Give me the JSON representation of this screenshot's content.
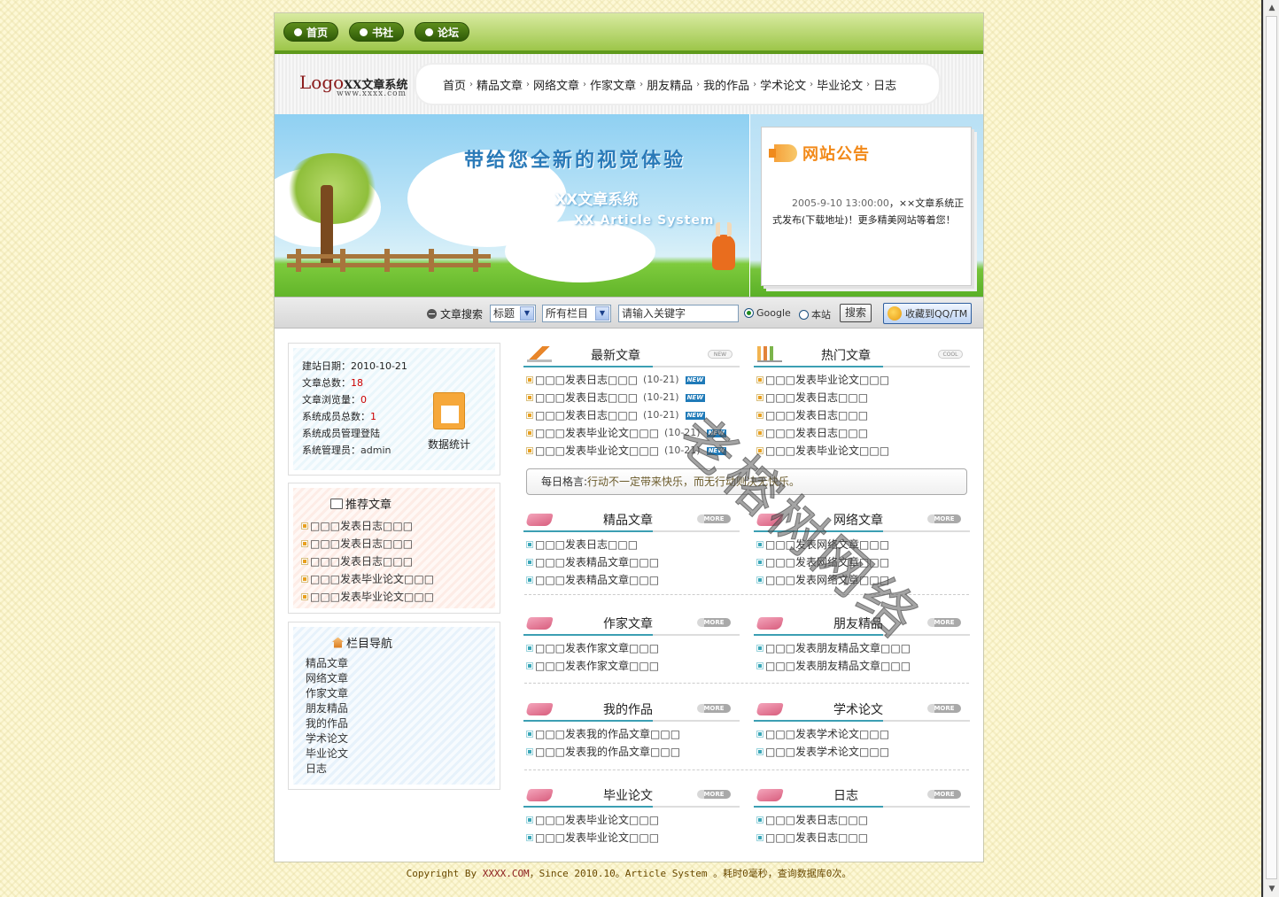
{
  "topnav": [
    "首页",
    "书社",
    "论坛"
  ],
  "logo": {
    "logo": "Logo",
    "name": "XX文章系统",
    "url": "www.xxxx.com"
  },
  "menu": [
    "首页",
    "精品文章",
    "网络文章",
    "作家文章",
    "朋友精品",
    "我的作品",
    "学术论文",
    "毕业论文",
    "日志"
  ],
  "menu_sep": "›",
  "banner": {
    "slogan": "带给您全新的视觉体验",
    "sys_cn": "XX文章系统",
    "sys_en": "XX Article System"
  },
  "notice": {
    "title": "网站公告",
    "date": "2005-9-10 13:00:00",
    "text": "，××文章系统正式发布(下载地址)！更多精美网站等着您！"
  },
  "search": {
    "label": "文章搜索",
    "field": "标题",
    "column": "所有栏目",
    "keyword": "请输入关键字",
    "opt_google": "Google",
    "opt_site": "本站",
    "button": "搜索",
    "fav": "收藏到QQ/TM"
  },
  "stats": {
    "rows": [
      {
        "label": "建站日期：",
        "value": "2010-10-21"
      },
      {
        "label": "文章总数：",
        "value": "18"
      },
      {
        "label": "文章浏览量：",
        "value": "0"
      },
      {
        "label": "系统成员总数：",
        "value": "1"
      },
      {
        "label": "系统成员管理登陆",
        "value": ""
      },
      {
        "label": "系统管理员：",
        "value": "admin"
      }
    ],
    "icon_label": "数据统计"
  },
  "recommend": {
    "title": "推荐文章",
    "items": [
      "□□□发表日志□□□",
      "□□□发表日志□□□",
      "□□□发表日志□□□",
      "□□□发表毕业论文□□□",
      "□□□发表毕业论文□□□"
    ]
  },
  "column_nav": {
    "title": "栏目导航",
    "items": [
      "精品文章",
      "网络文章",
      "作家文章",
      "朋友精品",
      "我的作品",
      "学术论文",
      "毕业论文",
      "日志"
    ]
  },
  "latest": {
    "title": "最新文章",
    "tag": "NEW",
    "badge": "NEW",
    "items": [
      {
        "text": "□□□发表日志□□□",
        "date": "(10-21)"
      },
      {
        "text": "□□□发表日志□□□",
        "date": "(10-21)"
      },
      {
        "text": "□□□发表日志□□□",
        "date": "(10-21)"
      },
      {
        "text": "□□□发表毕业论文□□□",
        "date": "(10-21)"
      },
      {
        "text": "□□□发表毕业论文□□□",
        "date": "(10-21)"
      }
    ]
  },
  "hot": {
    "title": "热门文章",
    "tag": "COOL",
    "items": [
      "□□□发表毕业论文□□□",
      "□□□发表日志□□□",
      "□□□发表日志□□□",
      "□□□发表日志□□□",
      "□□□发表毕业论文□□□"
    ]
  },
  "motto": {
    "label": "每日格言:",
    "text": "行动不一定带来快乐，而无行动则决无快乐。"
  },
  "more": "MORE",
  "sections": [
    {
      "title": "精品文章",
      "items": [
        "□□□发表日志□□□",
        "□□□发表精品文章□□□",
        "□□□发表精品文章□□□"
      ]
    },
    {
      "title": "网络文章",
      "items": [
        "□□□发表网络文章□□□",
        "□□□发表网络文章□□□",
        "□□□发表网络文章□□□"
      ]
    },
    {
      "title": "作家文章",
      "items": [
        "□□□发表作家文章□□□",
        "□□□发表作家文章□□□"
      ]
    },
    {
      "title": "朋友精品",
      "items": [
        "□□□发表朋友精品文章□□□",
        "□□□发表朋友精品文章□□□"
      ]
    },
    {
      "title": "我的作品",
      "items": [
        "□□□发表我的作品文章□□□",
        "□□□发表我的作品文章□□□"
      ]
    },
    {
      "title": "学术论文",
      "items": [
        "□□□发表学术论文□□□",
        "□□□发表学术论文□□□"
      ]
    },
    {
      "title": "毕业论文",
      "items": [
        "□□□发表毕业论文□□□",
        "□□□发表毕业论文□□□"
      ]
    },
    {
      "title": "日志",
      "items": [
        "□□□发表日志□□□",
        "□□□发表日志□□□"
      ]
    }
  ],
  "watermark": "老榕树网络",
  "footer": {
    "pre": "Copyright By ",
    "site": "XXXX.COM",
    "post": "，Since 2010.10。Article System 。耗时0毫秒，查询数据库0次。"
  }
}
